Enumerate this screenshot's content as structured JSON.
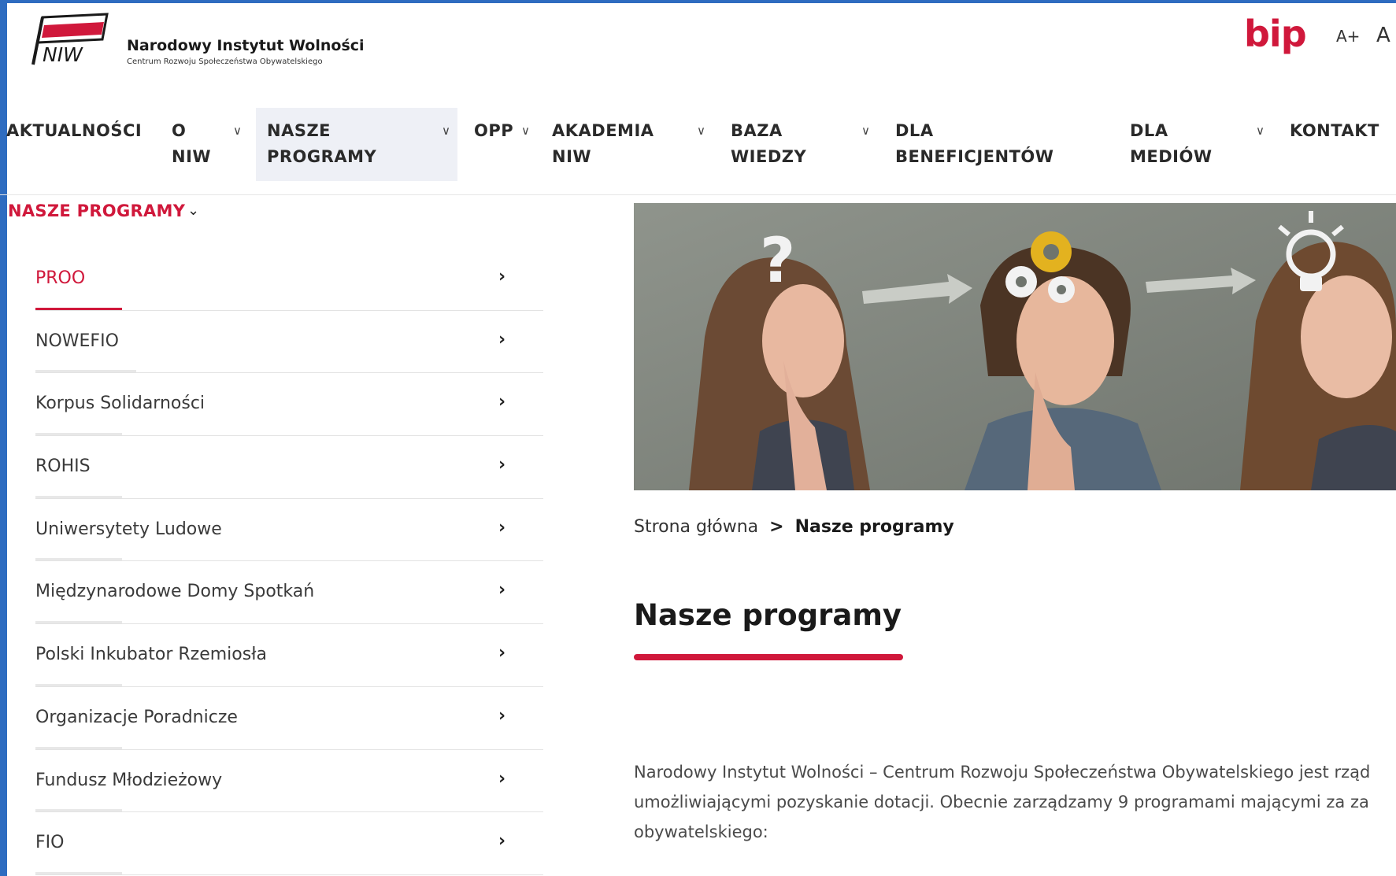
{
  "header": {
    "logo_text": "NIW",
    "brand_name": "Narodowy Instytut Wolności",
    "brand_sub": "Centrum Rozwoju Społeczeństwa Obywatelskiego",
    "bip": "bip",
    "font_increase": "A+",
    "font_default": "A"
  },
  "nav": {
    "items": [
      {
        "label": "AKTUALNOŚCI",
        "has_dropdown": false
      },
      {
        "label": "O\nNIW",
        "has_dropdown": true
      },
      {
        "label": "NASZE\nPROGRAMY",
        "has_dropdown": true,
        "active": true
      },
      {
        "label": "OPP",
        "has_dropdown": true
      },
      {
        "label": "AKADEMIA\nNIW",
        "has_dropdown": true
      },
      {
        "label": "BAZA\nWIEDZY",
        "has_dropdown": true
      },
      {
        "label": "DLA\nBENEFICJENTÓW",
        "has_dropdown": false
      },
      {
        "label": "DLA\nMEDIÓW",
        "has_dropdown": true
      },
      {
        "label": "KONTAKT",
        "has_dropdown": false
      }
    ]
  },
  "sidebar": {
    "title": "NASZE PROGRAMY",
    "items": [
      {
        "label": "PROO"
      },
      {
        "label": "NOWEFIO"
      },
      {
        "label": "Korpus Solidarności"
      },
      {
        "label": "ROHIS"
      },
      {
        "label": "Uniwersytety Ludowe"
      },
      {
        "label": "Międzynarodowe Domy Spotkań"
      },
      {
        "label": "Polski Inkubator Rzemiosła"
      },
      {
        "label": "Organizacje Poradnicze"
      },
      {
        "label": "Fundusz Młodzieżowy"
      },
      {
        "label": "FIO"
      }
    ]
  },
  "breadcrumb": {
    "home": "Strona główna",
    "separator": ">",
    "current": "Nasze programy"
  },
  "main": {
    "title": "Nasze programy",
    "intro_lines": [
      "Narodowy Instytut Wolności – Centrum Rozwoju Społeczeństwa Obywatelskiego jest rząd",
      "umożliwiającymi pozyskanie dotacji. Obecnie zarządzamy 9 programami mającymi za za",
      "obywatelskiego:"
    ]
  },
  "colors": {
    "accent": "#d0183b",
    "frame": "#2e6cc0",
    "nav_active_bg": "#eef0f6"
  }
}
